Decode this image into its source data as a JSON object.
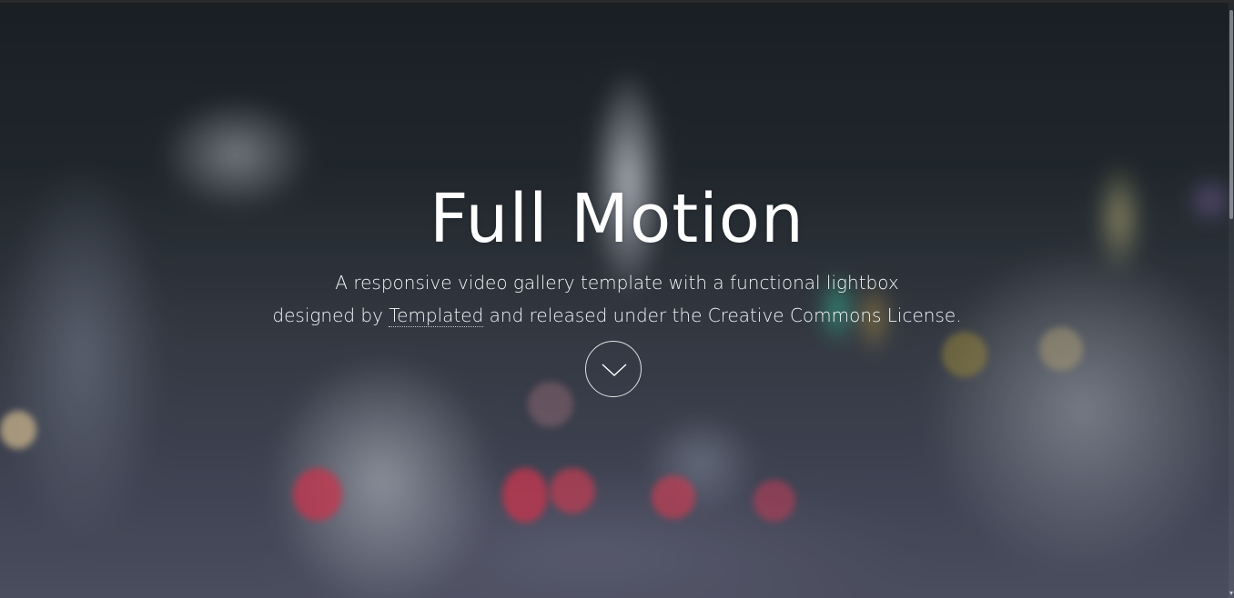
{
  "hero": {
    "title": "Full Motion",
    "description_line1": "A responsive video gallery template with a functional lightbox",
    "description_pre": "designed by ",
    "link_text": "Templated",
    "description_post": " and released under the Creative Commons License."
  },
  "more_button": {
    "icon": "chevron-down-icon"
  }
}
